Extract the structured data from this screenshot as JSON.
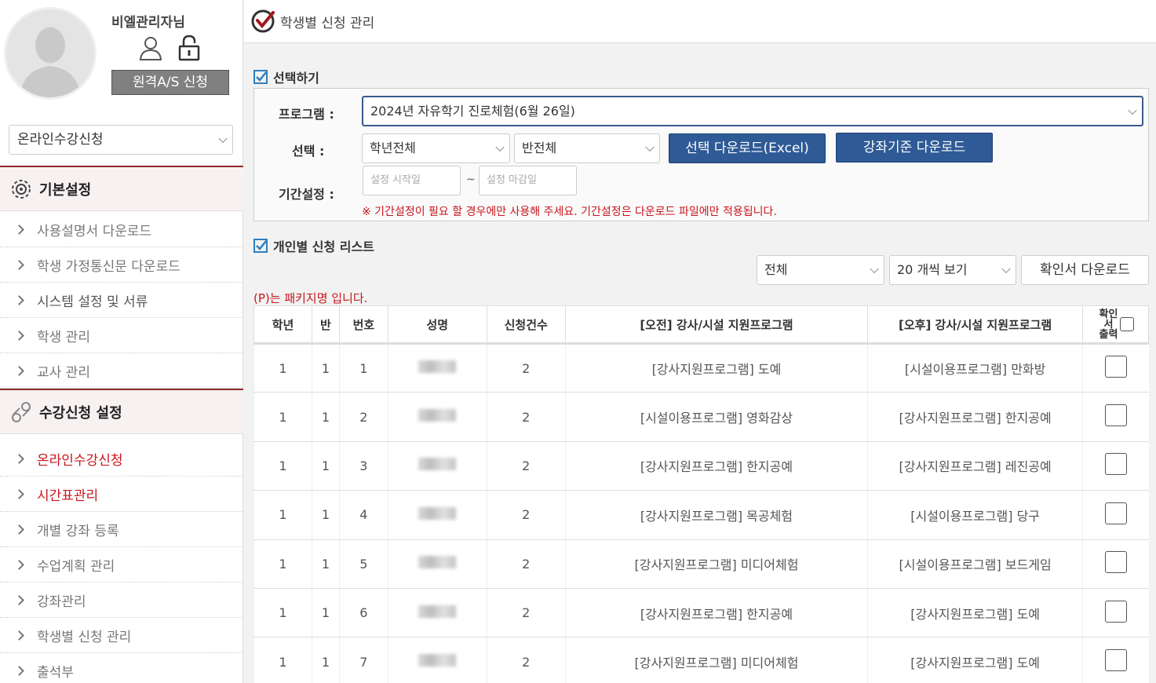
{
  "sidebar": {
    "admin_name": "비엘관리자님",
    "as_button": "원격A/S 신청",
    "course_select": "온라인수강신청",
    "section1": {
      "title": "기본설정",
      "items": [
        "사용설명서 다운로드",
        "학생 가정통신문 다운로드",
        "시스템 설정 및 서류",
        "학생 관리",
        "교사 관리"
      ]
    },
    "section2": {
      "title": "수강신청 설정",
      "items": [
        "온라인수강신청",
        "시간표관리",
        "개별 강좌 등록",
        "수업계획 관리",
        "강좌관리",
        "학생별 신청 관리",
        "출석부"
      ]
    }
  },
  "page": {
    "title": "학생별 신청 관리"
  },
  "select_section": {
    "title": "선택하기",
    "program_label": "프로그램 :",
    "program_value": "2024년 자유학기 진로체험(6월 26일)",
    "choice_label": "선택 :",
    "grade_select": "학년전체",
    "class_select": "반전체",
    "btn_excel": "선택 다운로드(Excel)",
    "btn_course": "강좌기준 다운로드",
    "period_label": "기간설정 :",
    "start_placeholder": "설정 시작일",
    "tilde": "~",
    "end_placeholder": "설정 마감일",
    "warning": "※ 기간설정이 필요 할 경우에만 사용해 주세요. 기간설정은 다운로드 파일에만 적용됩니다."
  },
  "list_section": {
    "title": "개인별 신청 리스트",
    "filter_select": "전체",
    "page_size_select": "20 개씩 보기",
    "confirm_download": "확인서 다운로드",
    "package_note": "(P)는 패키지명 입니다."
  },
  "table": {
    "headers": [
      "학년",
      "반",
      "번호",
      "성명",
      "신청건수",
      "[오전] 강사/시설 지원프로그램",
      "[오후] 강사/시설 지원프로그램"
    ],
    "print_header": "확인서 출력",
    "rows": [
      {
        "grade": "1",
        "class": "1",
        "no": "1",
        "count": "2",
        "am": "[강사지원프로그램] 도예",
        "pm": "[시설이용프로그램] 만화방"
      },
      {
        "grade": "1",
        "class": "1",
        "no": "2",
        "count": "2",
        "am": "[시설이용프로그램] 영화감상",
        "pm": "[강사지원프로그램] 한지공예"
      },
      {
        "grade": "1",
        "class": "1",
        "no": "3",
        "count": "2",
        "am": "[강사지원프로그램] 한지공예",
        "pm": "[강사지원프로그램] 레진공예"
      },
      {
        "grade": "1",
        "class": "1",
        "no": "4",
        "count": "2",
        "am": "[강사지원프로그램] 목공체험",
        "pm": "[시설이용프로그램] 당구"
      },
      {
        "grade": "1",
        "class": "1",
        "no": "5",
        "count": "2",
        "am": "[강사지원프로그램] 미디어체험",
        "pm": "[시설이용프로그램] 보드게임"
      },
      {
        "grade": "1",
        "class": "1",
        "no": "6",
        "count": "2",
        "am": "[강사지원프로그램] 한지공예",
        "pm": "[강사지원프로그램] 도예"
      },
      {
        "grade": "1",
        "class": "1",
        "no": "7",
        "count": "2",
        "am": "[강사지원프로그램] 미디어체험",
        "pm": "[강사지원프로그램] 도예"
      }
    ]
  },
  "colors": {
    "accent_red": "#c8161d",
    "button_blue": "#2e5a96",
    "section_border": "#8b2a2a"
  }
}
